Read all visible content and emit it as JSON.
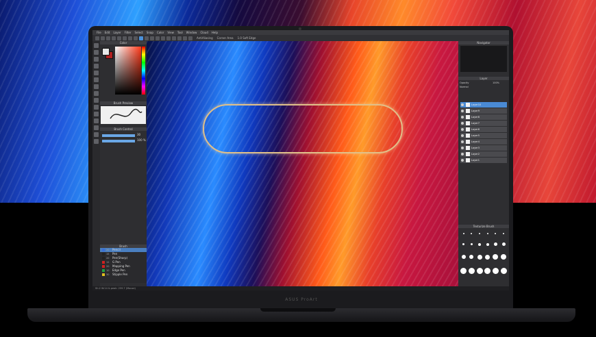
{
  "menubar": {
    "items": [
      "File",
      "Edit",
      "Layer",
      "Filter",
      "Select",
      "Snap",
      "Color",
      "View",
      "Tool",
      "Window",
      "Cloud",
      "Help"
    ]
  },
  "toolbar": {
    "info": "AntiAliasing",
    "mode": "Corner Area",
    "edge": "1.0 Soft Edge"
  },
  "panels": {
    "color": "Color",
    "brush_preview": "Brush Preview",
    "brush_control": "Brush Control",
    "brush": "Brush",
    "navigator": "Navigator",
    "layer": "Layer",
    "texturize": "Texturize Brush"
  },
  "brush_control": {
    "size_value": "30",
    "opacity_value": "100 %"
  },
  "brushes": [
    {
      "size": "20",
      "name": "Pencil",
      "color": "#3a6fd8",
      "selected": true
    },
    {
      "size": "15",
      "name": "Pen",
      "color": "#222222",
      "selected": false
    },
    {
      "size": "20",
      "name": "Pen(Sharp)",
      "color": "#222222",
      "selected": false
    },
    {
      "size": "12",
      "name": "G Pen",
      "color": "#d02020",
      "selected": false
    },
    {
      "size": "20",
      "name": "Mapping Pen",
      "color": "#d02020",
      "selected": false
    },
    {
      "size": "10",
      "name": "Edge Pen",
      "color": "#20a040",
      "selected": false
    },
    {
      "size": "30",
      "name": "Stipple Pen",
      "color": "#e0c020",
      "selected": false
    }
  ],
  "layer": {
    "blend": "Normal",
    "opacity_label": "Opacity",
    "opacity": "100%",
    "names": [
      "Layer10",
      "Layer9",
      "Layer8",
      "Layer7",
      "Layer6",
      "Layer5",
      "Layer4",
      "Layer3",
      "Layer2",
      "Layer1"
    ]
  },
  "status": "Sh:2 W:14 & peak: 259.7 (Mouse)",
  "brand": "ASUS ProArt"
}
